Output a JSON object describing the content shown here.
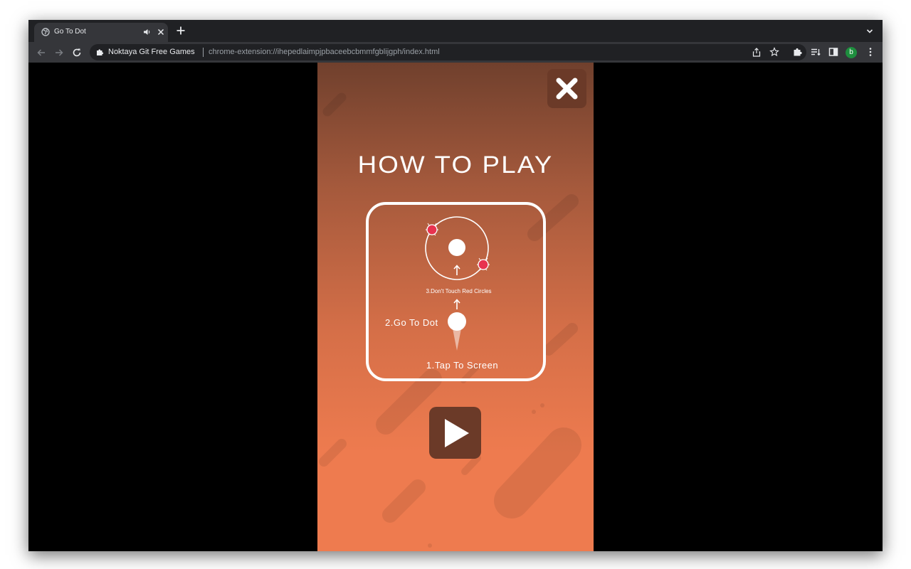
{
  "browser": {
    "tab_title": "Go To Dot",
    "site_name": "Noktaya Git Free Games",
    "url": "chrome-extension://ihepedlaimpjpbaceebcbmmfgblijgph/index.html",
    "profile_initial": "b",
    "accent_color": "#1e8e3e",
    "icons": [
      "globe-icon",
      "audio-icon",
      "close-icon",
      "plus-icon",
      "chevron-down-icon",
      "back-icon",
      "forward-icon",
      "reload-icon",
      "puzzle-icon",
      "share-icon",
      "star-icon",
      "extensions-icon",
      "reading-list-icon",
      "side-panel-icon",
      "more-icon"
    ]
  },
  "game": {
    "title": "HOW TO PLAY",
    "steps": {
      "step1": "1.Tap To Screen",
      "step2": "2.Go To Dot",
      "step3": "3.Don't Touch Red Circles"
    },
    "colors": {
      "top": "#70402d",
      "bottom": "#ee7b4f",
      "button": "#6b3a28",
      "red_circle": "#e8334f"
    },
    "icons": [
      "close-icon",
      "play-icon",
      "arrow-up-icon"
    ]
  }
}
